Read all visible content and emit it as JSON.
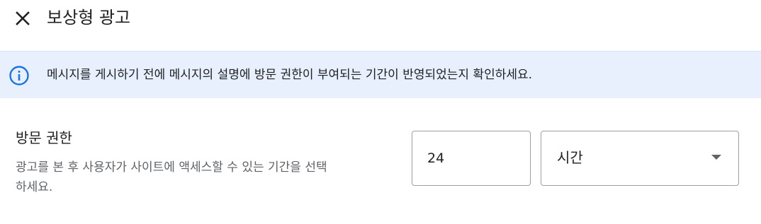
{
  "header": {
    "title": "보상형 광고",
    "close_icon": "close-icon"
  },
  "banner": {
    "icon": "info-icon",
    "accent_color": "#1a73e8",
    "background_color": "#e8f0fe",
    "text": "메시지를 게시하기 전에 메시지의 설명에 방문 권한이 부여되는 기간이 반영되었는지 확인하세요."
  },
  "access_field": {
    "label": "방문 권한",
    "help": "광고를 본 후 사용자가 사이트에 액세스할 수 있는 기간을 선택하세요.",
    "duration_value": "24",
    "unit": {
      "selected": "시간",
      "dropdown_icon": "chevron-down-icon"
    }
  }
}
